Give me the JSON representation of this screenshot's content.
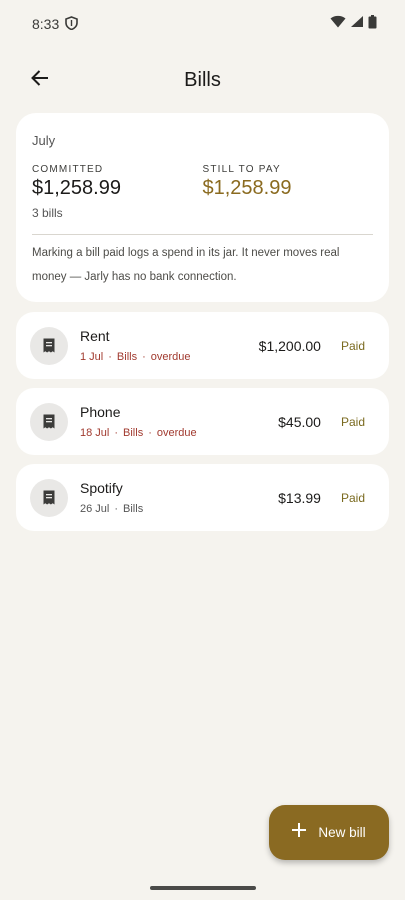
{
  "status": {
    "time": "8:33"
  },
  "header": {
    "title": "Bills"
  },
  "summary": {
    "month": "July",
    "committed_label": "COMMITTED",
    "committed_value": "$1,258.99",
    "still_label": "STILL TO PAY",
    "still_value": "$1,258.99",
    "bill_count": "3 bills",
    "note": "Marking a bill paid logs a spend in its jar. It never moves real money — Jarly has no bank connection."
  },
  "bills": [
    {
      "name": "Rent",
      "date": "1 Jul",
      "category": "Bills",
      "status": "overdue",
      "amount": "$1,200.00",
      "action": "Paid"
    },
    {
      "name": "Phone",
      "date": "18 Jul",
      "category": "Bills",
      "status": "overdue",
      "amount": "$45.00",
      "action": "Paid"
    },
    {
      "name": "Spotify",
      "date": "26 Jul",
      "category": "Bills",
      "status": "",
      "amount": "$13.99",
      "action": "Paid"
    }
  ],
  "fab": {
    "label": "New bill"
  },
  "colors": {
    "accent": "#8a6a22",
    "overdue": "#a13a2f",
    "background": "#f5f3ee"
  },
  "icons": {
    "back": "arrow-left-icon",
    "bill": "receipt-icon",
    "add": "plus-icon"
  }
}
